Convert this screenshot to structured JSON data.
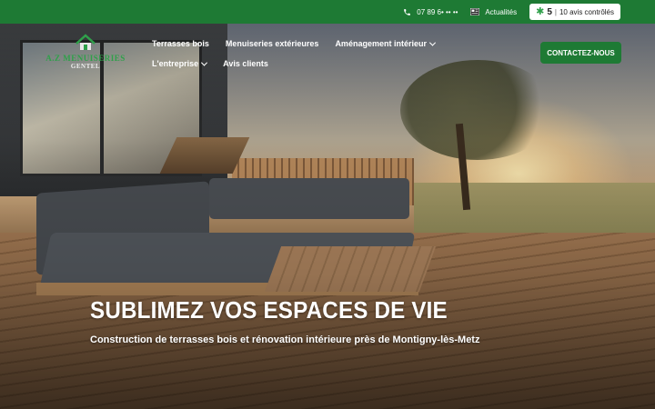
{
  "topbar": {
    "phone": "07 89 6• •• ••",
    "news_label": "Actualités",
    "reviews": {
      "star": "✱",
      "score": "5",
      "separator": "|",
      "label": "10 avis contrôlés"
    }
  },
  "logo": {
    "title": "A.Z MENUISERIES",
    "subtitle": "GENTEL"
  },
  "nav": {
    "items": [
      {
        "label": "Terrasses bois",
        "has_dropdown": false
      },
      {
        "label": "Menuiseries extérieures",
        "has_dropdown": false
      },
      {
        "label": "Aménagement intérieur",
        "has_dropdown": true
      },
      {
        "label": "L'entreprise",
        "has_dropdown": true
      },
      {
        "label": "Avis clients",
        "has_dropdown": false
      }
    ],
    "cta_label": "CONTACTEZ-NOUS"
  },
  "hero": {
    "title": "SUBLIMEZ VOS ESPACES DE VIE",
    "subtitle": "Construction de terrasses bois et rénovation intérieure près de Montigny-lès-Metz"
  },
  "colors": {
    "brand_green": "#1e7a34",
    "accent_green": "#2fa04a",
    "text_white": "#ffffff"
  },
  "icons": {
    "phone": "phone-icon",
    "news": "newspaper-icon",
    "review_star": "star-icon",
    "dropdown": "chevron-down-icon"
  }
}
